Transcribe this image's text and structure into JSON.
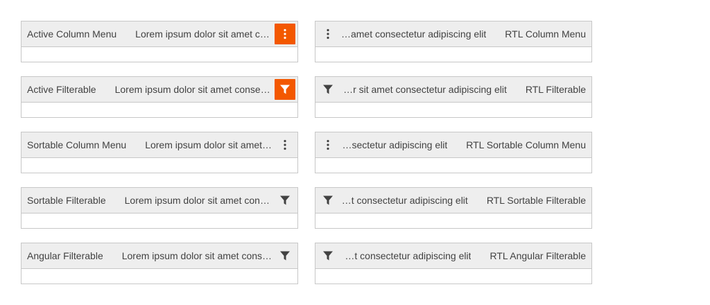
{
  "accent_color": "#f35800",
  "ltr_grids": [
    {
      "label": "Active Column Menu",
      "text": "Lorem ipsum dolor sit amet consectetur adipiscing elit",
      "icon": "column-menu-icon",
      "active": true
    },
    {
      "label": "Active Filterable",
      "text": "Lorem ipsum dolor sit amet consectetur adipiscing elit",
      "icon": "filter-icon",
      "active": true
    },
    {
      "label": "Sortable Column Menu",
      "text": "Lorem ipsum dolor sit amet consectetur adipiscing elit",
      "icon": "column-menu-icon",
      "active": false
    },
    {
      "label": "Sortable Filterable",
      "text": "Lorem ipsum dolor sit amet consectetur adipiscing elit",
      "icon": "filter-icon",
      "active": false
    },
    {
      "label": "Angular Filterable",
      "text": "Lorem ipsum dolor sit amet consectetur adipiscing elit",
      "icon": "filter-icon",
      "active": false
    }
  ],
  "rtl_grids": [
    {
      "label": "RTL Column Menu",
      "text": "Lorem ipsum dolor sit amet consectetur adipiscing elit",
      "icon": "column-menu-icon",
      "active": false
    },
    {
      "label": "RTL Filterable",
      "text": "Lorem ipsum dolor sit amet consectetur adipiscing elit",
      "icon": "filter-icon",
      "active": false
    },
    {
      "label": "RTL Sortable Column Menu",
      "text": "Lorem ipsum dolor sit amet consectetur adipiscing elit",
      "icon": "column-menu-icon",
      "active": false
    },
    {
      "label": "RTL Sortable Filterable",
      "text": "Lorem ipsum dolor sit amet consectetur adipiscing elit",
      "icon": "filter-icon",
      "active": false
    },
    {
      "label": "RTL Angular Filterable",
      "text": "Lorem ipsum dolor sit amet consectetur adipiscing elit",
      "icon": "filter-icon",
      "active": false
    }
  ]
}
